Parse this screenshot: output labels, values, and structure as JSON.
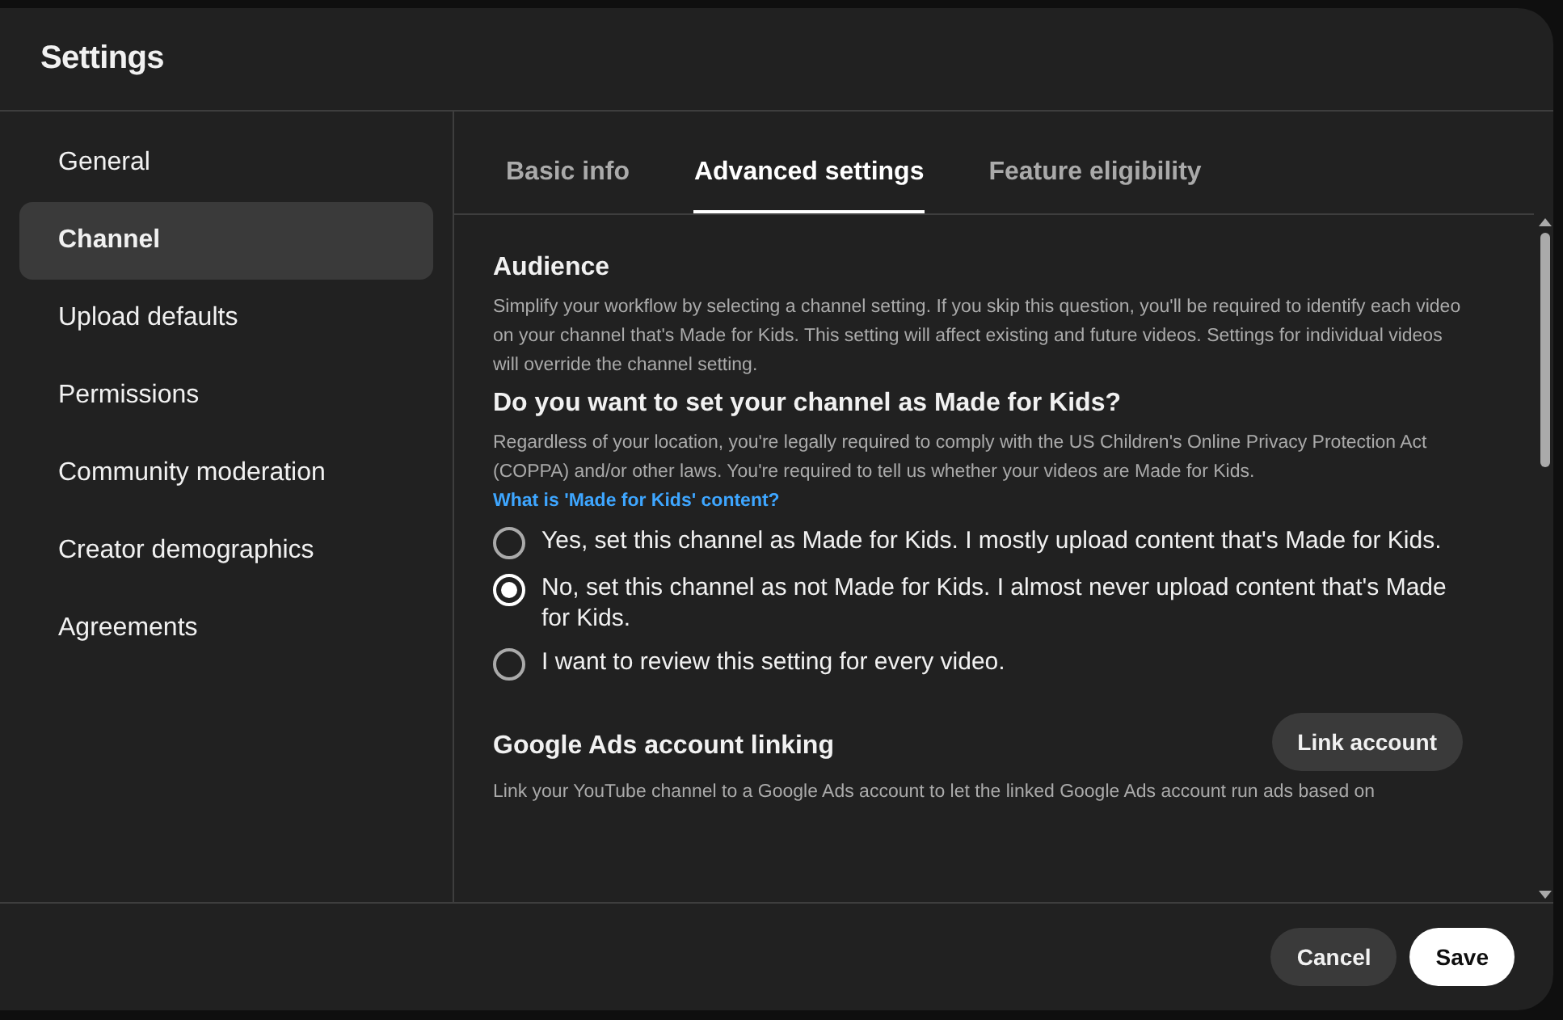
{
  "window": {
    "title": "Settings"
  },
  "sidebar": {
    "items": [
      {
        "label": "General",
        "selected": false
      },
      {
        "label": "Channel",
        "selected": true
      },
      {
        "label": "Upload defaults",
        "selected": false
      },
      {
        "label": "Permissions",
        "selected": false
      },
      {
        "label": "Community moderation",
        "selected": false
      },
      {
        "label": "Creator demographics",
        "selected": false
      },
      {
        "label": "Agreements",
        "selected": false
      }
    ]
  },
  "tabs": [
    {
      "label": "Basic info",
      "selected": false
    },
    {
      "label": "Advanced settings",
      "selected": true
    },
    {
      "label": "Feature eligibility",
      "selected": false
    }
  ],
  "audience": {
    "heading": "Audience",
    "description": "Simplify your workflow by selecting a channel setting. If you skip this question, you'll be required to identify each video on your channel that's Made for Kids. This setting will affect existing and future videos. Settings for individual videos will override the channel setting.",
    "question": "Do you want to set your channel as Made for Kids?",
    "note": "Regardless of your location, you're legally required to comply with the US Children's Online Privacy Protection Act (COPPA) and/or other laws. You're required to tell us whether your videos are Made for Kids.",
    "link": "What is 'Made for Kids' content?",
    "options": [
      {
        "label": "Yes, set this channel as Made for Kids. I mostly upload content that's Made for Kids.",
        "selected": false
      },
      {
        "label": "No, set this channel as not Made for Kids. I almost never upload content that's Made for Kids.",
        "selected": true
      },
      {
        "label": "I want to review this setting for every video.",
        "selected": false
      }
    ]
  },
  "ads": {
    "heading": "Google Ads account linking",
    "button": "Link account",
    "description": "Link your YouTube channel to a Google Ads account to let the linked Google Ads account run ads based on"
  },
  "footer": {
    "buttons": [
      {
        "label": "Cancel",
        "kind": "secondary"
      },
      {
        "label": "Save",
        "kind": "primary"
      }
    ]
  }
}
